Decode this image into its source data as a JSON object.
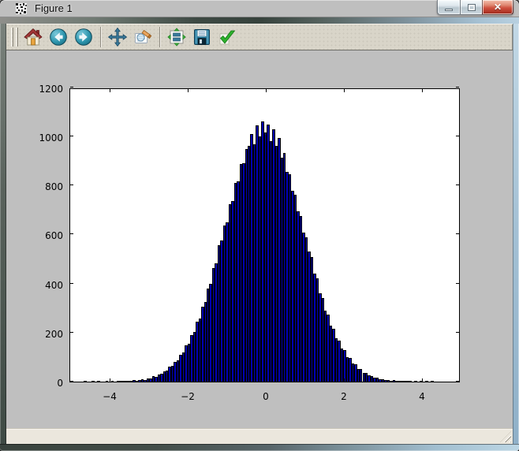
{
  "titlebar": {
    "title": "Figure 1",
    "buttons": [
      {
        "name": "minimize"
      },
      {
        "name": "maximize"
      },
      {
        "name": "close"
      }
    ]
  },
  "toolbar": {
    "buttons": [
      {
        "name": "home",
        "icon": "home-icon"
      },
      {
        "name": "back",
        "icon": "back-icon"
      },
      {
        "name": "forward",
        "icon": "forward-icon"
      },
      {
        "name": "pan",
        "icon": "pan-icon"
      },
      {
        "name": "zoom-to-rect",
        "icon": "zoom-rect-icon"
      },
      {
        "name": "configure-subplots",
        "icon": "subplots-icon"
      },
      {
        "name": "save",
        "icon": "save-icon"
      },
      {
        "name": "apply",
        "icon": "check-icon"
      }
    ]
  },
  "colors": {
    "figure_bg": "#bfbfbf",
    "plot_bg": "#ffffff",
    "bar_fill": "#0000b2",
    "bar_edge": "#000000",
    "toolbar_bg": "#d9d5c9",
    "statusbar_bg": "#ebe7dd",
    "close_button_red": "#cf5240"
  },
  "chart_data": {
    "type": "bar",
    "subtype": "histogram",
    "title": "",
    "xlabel": "",
    "ylabel": "",
    "grid": false,
    "legend": null,
    "xlim": [
      -5,
      5
    ],
    "ylim": [
      0,
      1200
    ],
    "xticks": [
      -4,
      -2,
      0,
      2,
      4
    ],
    "xtick_labels": [
      "−4",
      "−2",
      "0",
      "2",
      "4"
    ],
    "yticks": [
      0,
      200,
      400,
      600,
      800,
      1000,
      1200
    ],
    "ytick_labels": [
      "0",
      "200",
      "400",
      "600",
      "800",
      "1000",
      "1200"
    ],
    "bin_start": -4.655,
    "bin_width": 0.07,
    "values": [
      1,
      0,
      0,
      1,
      0,
      1,
      0,
      0,
      1,
      0,
      1,
      0,
      1,
      2,
      1,
      2,
      3,
      2,
      5,
      4,
      7,
      9,
      8,
      14,
      13,
      21,
      20,
      30,
      31,
      43,
      45,
      60,
      63,
      82,
      88,
      110,
      118,
      147,
      155,
      190,
      203,
      244,
      258,
      307,
      324,
      381,
      399,
      464,
      483,
      556,
      575,
      638,
      650,
      725,
      736,
      810,
      818,
      888,
      890,
      948,
      962,
      1010,
      968,
      1045,
      1000,
      1062,
      1018,
      1048,
      980,
      1030,
      962,
      995,
      915,
      932,
      856,
      846,
      780,
      764,
      695,
      677,
      608,
      589,
      530,
      507,
      441,
      420,
      360,
      342,
      288,
      274,
      227,
      216,
      176,
      168,
      134,
      128,
      100,
      95,
      73,
      70,
      52,
      50,
      37,
      35,
      25,
      24,
      17,
      16,
      11,
      11,
      7,
      7,
      4,
      5,
      3,
      2,
      2,
      1,
      2,
      1,
      0,
      1,
      0,
      1,
      0,
      1,
      0,
      1
    ]
  }
}
